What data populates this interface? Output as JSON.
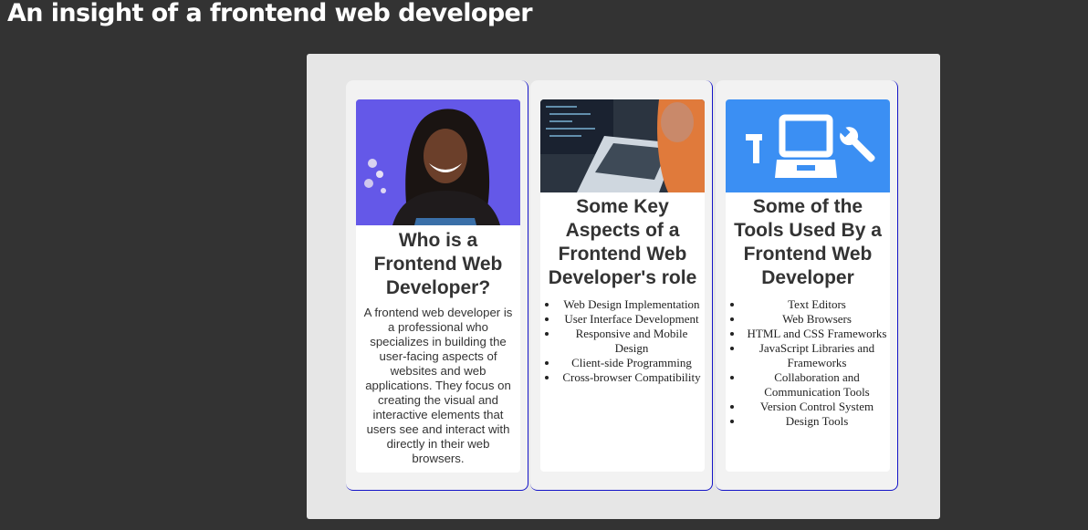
{
  "page": {
    "title": "An insight of a frontend web developer"
  },
  "cards": [
    {
      "title": "Who is a Frontend Web Developer?",
      "image": "developer-portrait-image",
      "description": "A frontend web developer is a professional who specializes in building the user-facing aspects of websites and web applications. They focus on creating the visual and interactive elements that users see and interact with directly in their web browsers."
    },
    {
      "title": "Some Key Aspects of a Frontend Web Developer's role",
      "image": "coding-laptop-image",
      "items": [
        "Web Design Implementation",
        "User Interface Development",
        "Responsive and Mobile Design",
        "Client-side Programming",
        "Cross-browser Compatibility"
      ]
    },
    {
      "title": "Some of the Tools Used By a Frontend Web Developer",
      "image": "tools-icon-image",
      "items": [
        "Text Editors",
        "Web Browsers",
        "HTML and CSS Frameworks",
        "JavaScript Libraries and Frameworks",
        "Collaboration and Communication Tools",
        "Version Control System",
        "Design Tools"
      ]
    }
  ],
  "colors": {
    "background": "#333333",
    "panel": "#e6e6e6",
    "card": "#f2f2f2",
    "card_border": "#1515c8",
    "tools_icon_bg": "#3b8ff3"
  }
}
